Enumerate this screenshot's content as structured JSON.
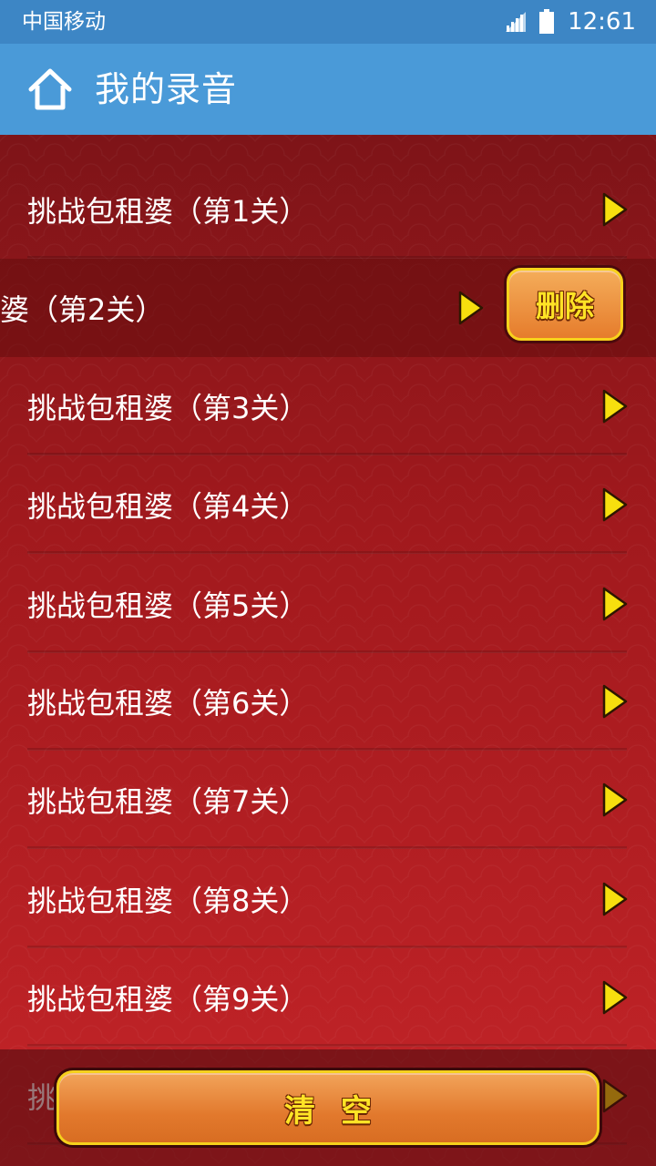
{
  "status_bar": {
    "carrier": "中国移动",
    "time": "12:61",
    "signal_icon": "signal-icon",
    "battery_icon": "battery-icon"
  },
  "header": {
    "title": "我的录音",
    "home_icon": "home-icon",
    "background": "#4a9ad8"
  },
  "recordings": [
    {
      "label": "挑战包租婆（第1关）"
    },
    {
      "label": "婆（第2关）",
      "swiped": true
    },
    {
      "label": "挑战包租婆（第3关）"
    },
    {
      "label": "挑战包租婆（第4关）"
    },
    {
      "label": "挑战包租婆（第5关）"
    },
    {
      "label": "挑战包租婆（第6关）"
    },
    {
      "label": "挑战包租婆（第7关）"
    },
    {
      "label": "挑战包租婆（第8关）"
    },
    {
      "label": "挑战包租婆（第9关）"
    },
    {
      "label": "挑"
    }
  ],
  "delete_label": "删除",
  "clear_label": "清空",
  "colors": {
    "accent_yellow": "#ffe326",
    "button_orange": "#e67c2c",
    "list_red": "#b11e22",
    "status_blue": "#3d86c5"
  }
}
